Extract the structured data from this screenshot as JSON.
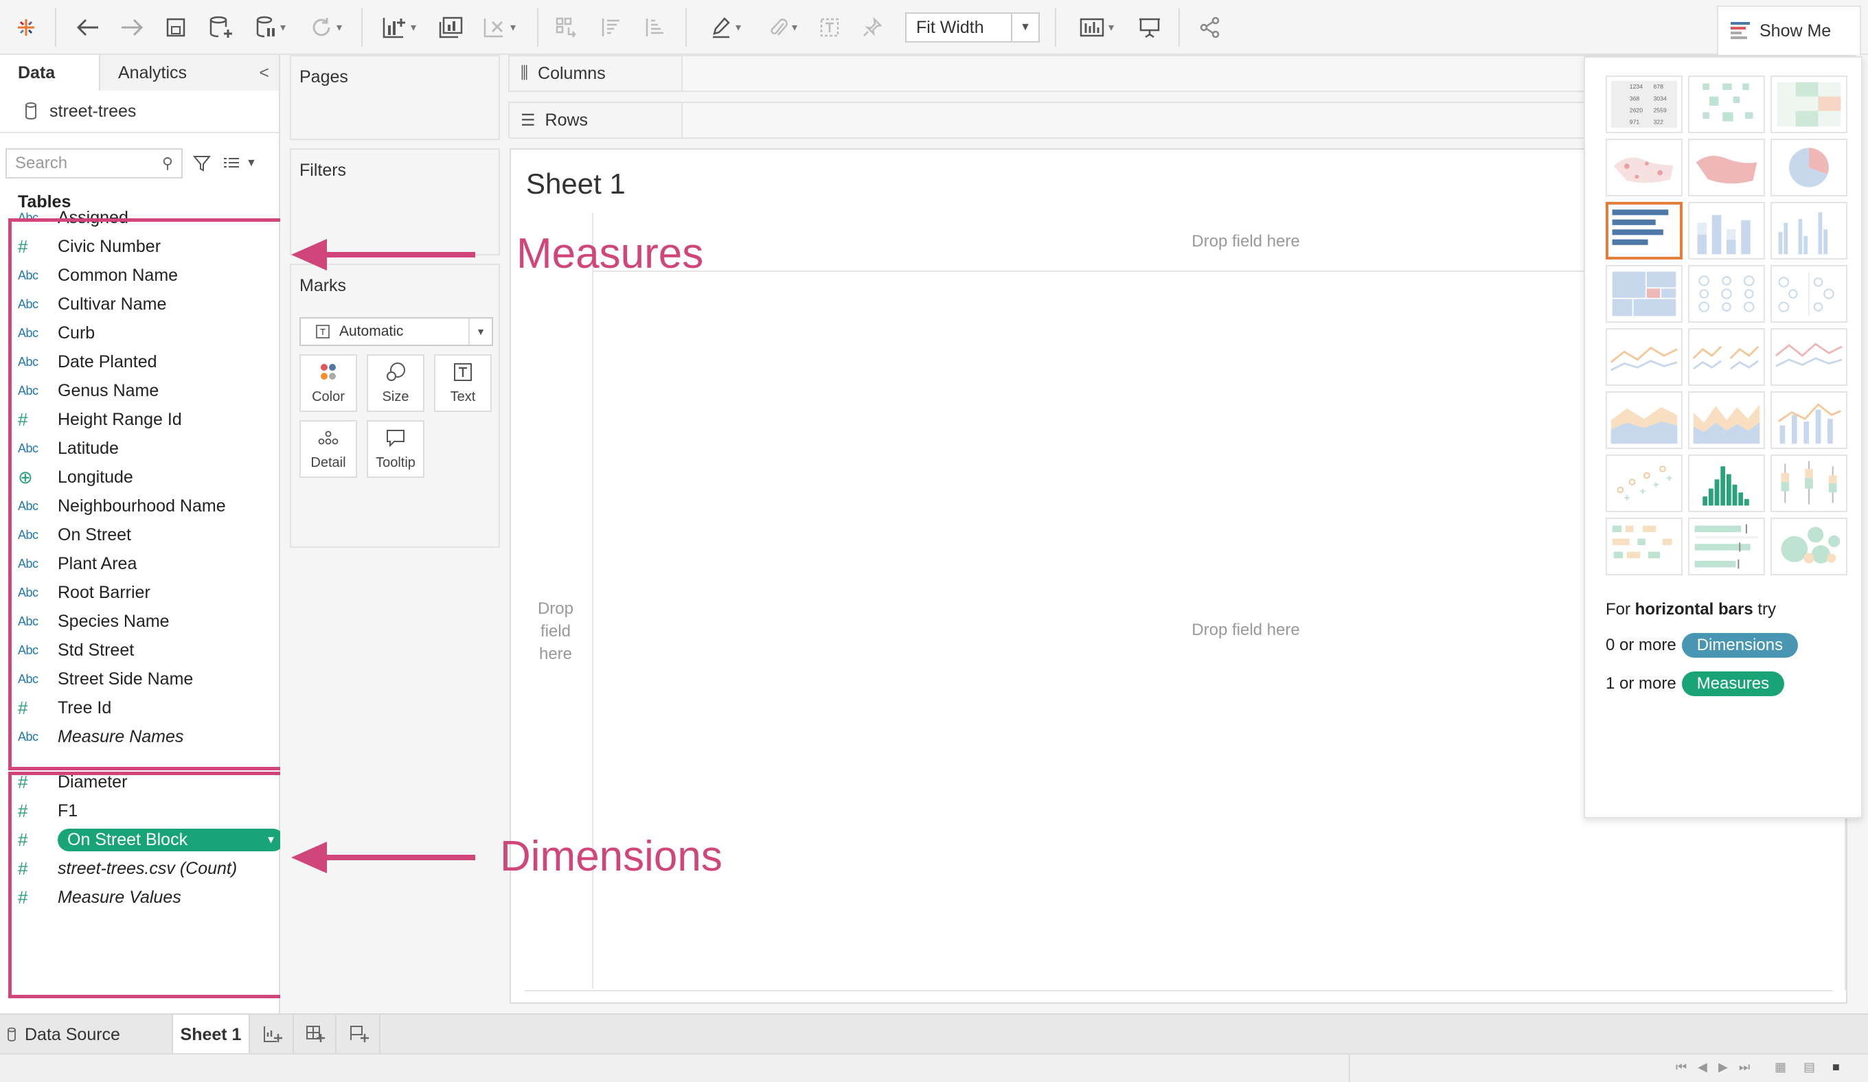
{
  "toolbar": {
    "icons": [
      "tableau-logo-icon",
      "undo-icon",
      "redo-icon",
      "save-icon",
      "new-data-source-icon",
      "pause-updates-icon",
      "refresh-icon",
      "new-worksheet-icon",
      "duplicate-sheet-icon",
      "clear-sheet-icon",
      "swap-icon",
      "sort-ascending-icon",
      "sort-descending-icon",
      "highlight-icon",
      "group-icon",
      "labels-icon",
      "fix-axes-icon",
      "show-cards-icon",
      "presentation-icon",
      "share-icon"
    ],
    "fit_label": "Fit Width",
    "show_me_label": "Show Me"
  },
  "data_pane": {
    "tab_data": "Data",
    "tab_analytics": "Analytics",
    "collapse": "<",
    "data_source": "street-trees",
    "search_placeholder": "Search",
    "tables_heading": "Tables",
    "fields": [
      {
        "type": "Abc",
        "name": "Assigned"
      },
      {
        "type": "#",
        "name": "Civic Number"
      },
      {
        "type": "Abc",
        "name": "Common Name"
      },
      {
        "type": "Abc",
        "name": "Cultivar Name"
      },
      {
        "type": "Abc",
        "name": "Curb"
      },
      {
        "type": "Abc",
        "name": "Date Planted"
      },
      {
        "type": "Abc",
        "name": "Genus Name"
      },
      {
        "type": "#",
        "name": "Height Range Id"
      },
      {
        "type": "Abc",
        "name": "Latitude"
      },
      {
        "type": "globe",
        "name": "Longitude"
      },
      {
        "type": "Abc",
        "name": "Neighbourhood Name"
      },
      {
        "type": "Abc",
        "name": "On Street"
      },
      {
        "type": "Abc",
        "name": "Plant Area"
      },
      {
        "type": "Abc",
        "name": "Root Barrier"
      },
      {
        "type": "Abc",
        "name": "Species Name"
      },
      {
        "type": "Abc",
        "name": "Std Street"
      },
      {
        "type": "Abc",
        "name": "Street Side Name"
      },
      {
        "type": "#",
        "name": "Tree Id"
      },
      {
        "type": "Abc",
        "name": "Measure Names"
      },
      {
        "type": "#",
        "name": "Diameter"
      },
      {
        "type": "#",
        "name": "F1"
      },
      {
        "type": "#",
        "name": "On Street Block"
      },
      {
        "type": "#",
        "name": "street-trees.csv (Count)"
      },
      {
        "type": "#",
        "name": "Measure Values"
      }
    ]
  },
  "shelves": {
    "pages": "Pages",
    "filters": "Filters",
    "marks": "Marks",
    "mark_type": "Automatic",
    "mark_buttons": [
      "Color",
      "Size",
      "Text",
      "Detail",
      "Tooltip"
    ],
    "columns": "Columns",
    "rows": "Rows"
  },
  "sheet": {
    "title": "Sheet 1",
    "drop_top": "Drop field here",
    "drop_left_lines": [
      "Drop",
      "field",
      "here"
    ],
    "drop_center": "Drop field here"
  },
  "annotations": {
    "measures": "Measures",
    "dimensions": "Dimensions"
  },
  "show_me": {
    "hint_prefix": "For",
    "hint_bold": "horizontal bars",
    "hint_suffix": "try",
    "row1_prefix": "0 or more",
    "row1_chip": "Dimensions",
    "row2_prefix": "1 or more",
    "row2_chip": "Measures",
    "text_table_values": [
      "1234",
      "678",
      "368",
      "3034",
      "2620",
      "2559",
      "971",
      "322"
    ]
  },
  "bottom": {
    "data_source_tab": "Data Source",
    "sheet_tab": "Sheet 1"
  },
  "colors": {
    "annotation": "#d0457a",
    "dimension_chip": "#4996b2",
    "measure_chip": "#19a477",
    "selected_thumb": "#e37d3c"
  }
}
